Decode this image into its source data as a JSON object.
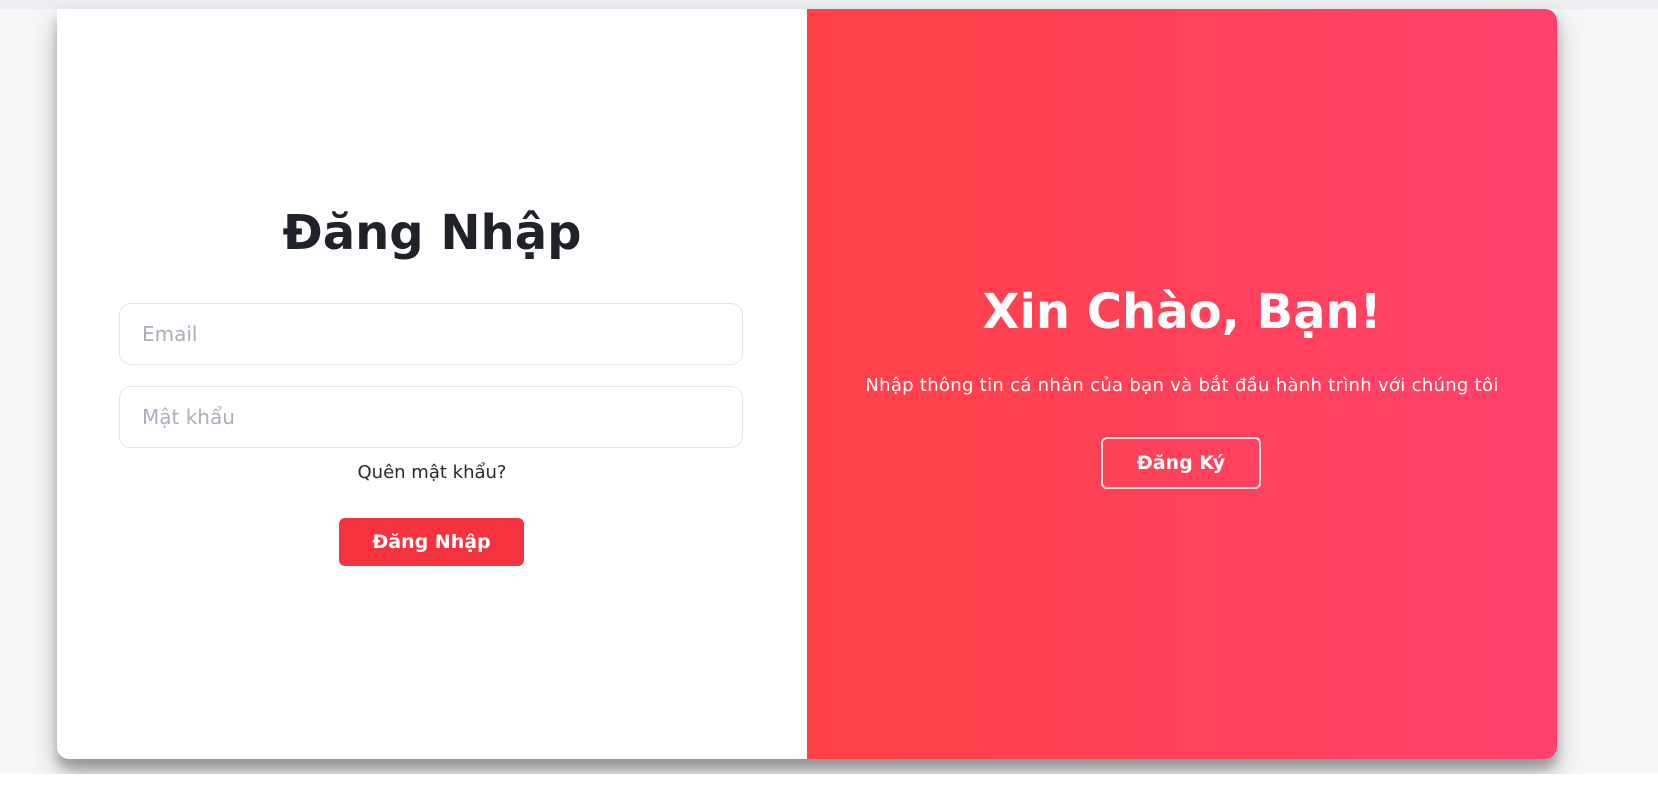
{
  "login": {
    "title": "Đăng Nhập",
    "email_placeholder": "Email",
    "password_placeholder": "Mật khẩu",
    "forgot_password": "Quên mật khẩu?",
    "submit_label": "Đăng Nhập"
  },
  "welcome": {
    "title": "Xin Chào, Bạn!",
    "text": "Nhập thông tin cá nhân của bạn và bắt đầu hành trình với chúng tôi",
    "register_label": "Đăng Ký"
  },
  "colors": {
    "accent": "#f5333f",
    "gradient_start": "#ff4146",
    "gradient_end": "#ff416c",
    "title_text": "#1f2329"
  }
}
